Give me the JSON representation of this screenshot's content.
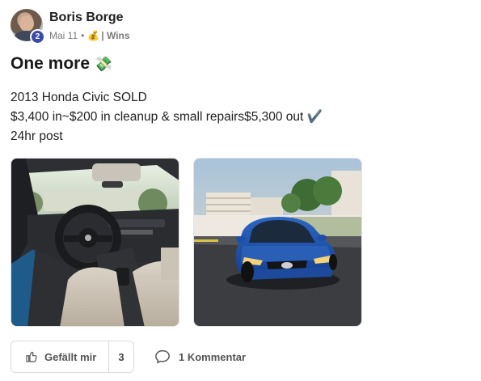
{
  "post": {
    "author": "Boris Borge",
    "level": "2",
    "date": "Mai 11",
    "separator": "•",
    "category_emoji": "💰",
    "category": "| Wins",
    "title": "One more",
    "title_emoji": "💸",
    "body": [
      "2013 Honda Civic SOLD",
      "$3,400 in~$200 in cleanup & small repairs$5,300 out ✔️",
      "24hr post"
    ],
    "images": [
      {
        "icon": "car-interior-photo"
      },
      {
        "icon": "blue-honda-civic-photo"
      }
    ]
  },
  "actions": {
    "like_label": "Gefällt mir",
    "like_count": "3",
    "comment_label": "1 Kommentar"
  },
  "colors": {
    "badge": "#3b4aa8",
    "car_blue": "#1f4fa8",
    "text": "#1f1f1f",
    "muted": "#7a7a7a"
  }
}
